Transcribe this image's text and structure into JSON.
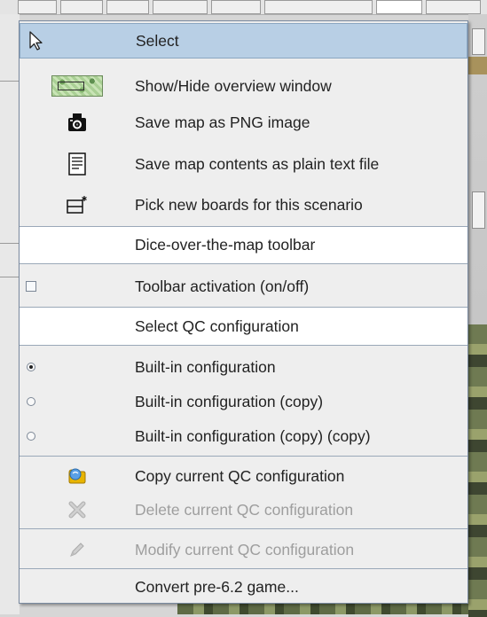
{
  "menu": {
    "items": [
      {
        "label": "Select",
        "icon": "cursor-icon",
        "state": "highlighted"
      },
      {
        "label": "Show/Hide overview window",
        "icon": "overview-map-icon"
      },
      {
        "label": "Save map as PNG image",
        "icon": "camera-icon"
      },
      {
        "label": "Save map contents as plain text file",
        "icon": "text-file-icon"
      },
      {
        "label": "Pick new boards for this scenario",
        "icon": "boards-icon"
      },
      {
        "label": "Dice-over-the-map toolbar",
        "icon": ""
      },
      {
        "label": "Toolbar activation (on/off)",
        "icon": "checkbox-icon",
        "checked": false
      },
      {
        "label": "Select QC configuration",
        "icon": ""
      },
      {
        "label": "Built-in configuration",
        "icon": "radio-icon",
        "selected": true
      },
      {
        "label": "Built-in configuration (copy)",
        "icon": "radio-icon",
        "selected": false
      },
      {
        "label": "Built-in configuration (copy) (copy)",
        "icon": "radio-icon",
        "selected": false
      },
      {
        "label": "Copy current QC configuration",
        "icon": "copy-icon"
      },
      {
        "label": "Delete current QC configuration",
        "icon": "delete-icon",
        "enabled": false
      },
      {
        "label": "Modify current QC configuration",
        "icon": "pencil-icon",
        "enabled": false
      },
      {
        "label": "Convert pre-6.2 game...",
        "icon": ""
      }
    ]
  },
  "colors": {
    "highlight": "#b8cfe5",
    "menu_background": "#eeeeee",
    "header_background": "#ffffff",
    "disabled_text": "#9e9e9e"
  }
}
